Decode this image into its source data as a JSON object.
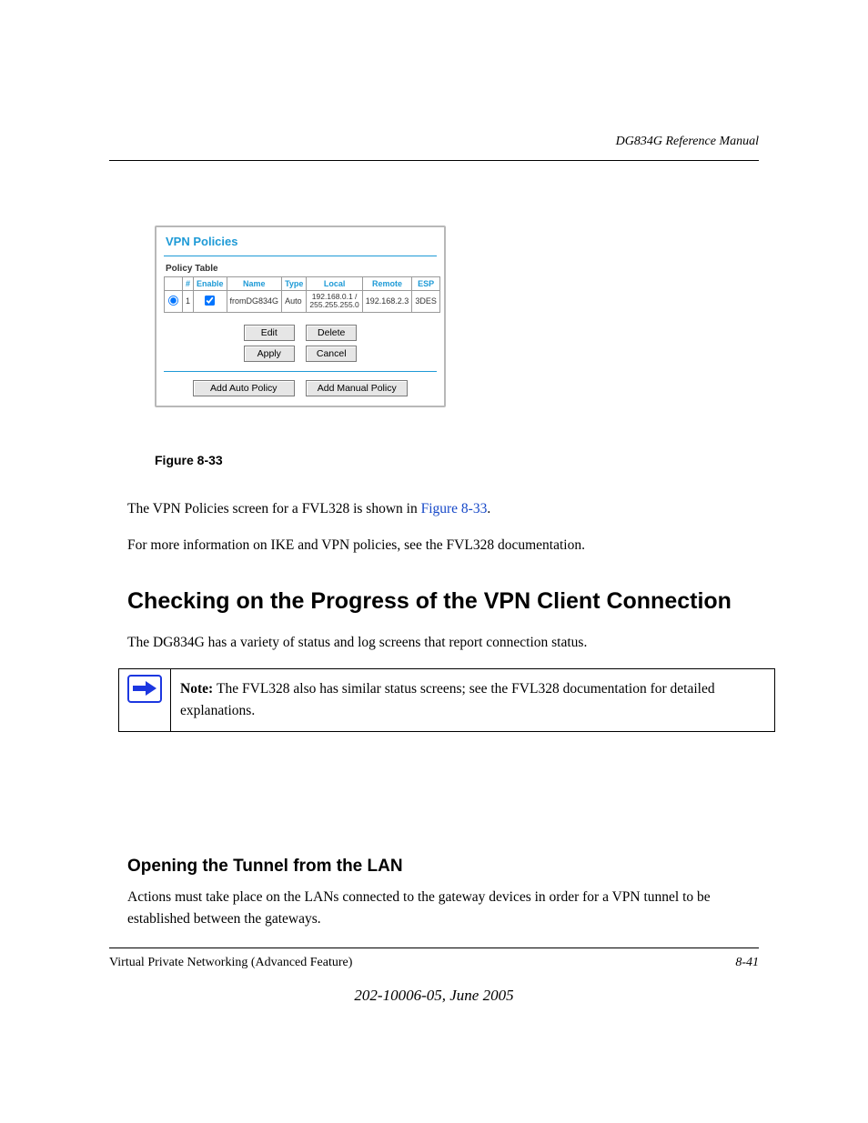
{
  "header": {
    "running_head": "DG834G Reference Manual"
  },
  "screenshot": {
    "title": "VPN Policies",
    "subtitle": "Policy Table",
    "columns": {
      "select": "",
      "idx": "#",
      "enable": "Enable",
      "name": "Name",
      "type": "Type",
      "local": "Local",
      "remote": "Remote",
      "esp": "ESP"
    },
    "row": {
      "idx": "1",
      "name": "fromDG834G",
      "type": "Auto",
      "local_line1": "192.168.0.1 /",
      "local_line2": "255.255.255.0",
      "remote": "192.168.2.3",
      "esp": "3DES"
    },
    "buttons": {
      "edit": "Edit",
      "delete": "Delete",
      "apply": "Apply",
      "cancel": "Cancel",
      "add_auto": "Add Auto Policy",
      "add_manual": "Add Manual Policy"
    }
  },
  "figure_caption": "Figure 8-33",
  "body": {
    "p1_a": "The VPN Policies screen for a FVL328 is shown in ",
    "p1_link": "Figure 8-33",
    "p1_b": ".",
    "p2": "For more information on IKE and VPN policies, see the FVL328 documentation.",
    "section_heading": "Checking on the Progress of the VPN Client Connection",
    "p3": "The DG834G has a variety of status and log screens that report connection status.",
    "note_label": "Note: ",
    "note_body": "The FVL328 also has similar status screens; see the FVL328 documentation for detailed explanations."
  },
  "otp": {
    "heading": "Opening the Tunnel from the LAN",
    "para": "Actions must take place on the LANs connected to the gateway devices in order for a VPN tunnel to be established between the gateways."
  },
  "footer": {
    "left": "Virtual Private Networking (Advanced Feature)",
    "right": "8-41",
    "draft_a": "202-10006-05, ",
    "draft_b": "June 2005"
  }
}
